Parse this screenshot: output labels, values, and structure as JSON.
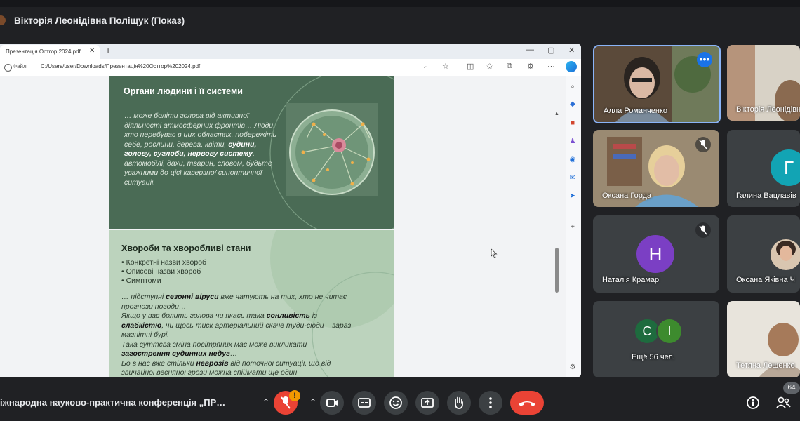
{
  "presenter": {
    "title": "Вікторія Леонідівна Поліщук (Показ)"
  },
  "browser": {
    "tab_title": "Презентація Остгор 2024.pdf",
    "address_prefix": "Файл",
    "address_url": "C:/Users/user/Downloads/Презентація%20Остгор%202024.pdf"
  },
  "slide1": {
    "title": "Органи людини і її системи",
    "text_1": "… може боліти голова від активної діяльності атмосферних фронтів… Люди, хто перебуває в цих областях, побережіть себе, рослини, дерева, квіти, ",
    "text_bold": "судини, голову, суглоби, нервову систему",
    "text_2": ", автомобілі, дахи, тварин, словом, будьте уважними до цієї каверзної синоптичної ситуації."
  },
  "slide2": {
    "title": "Хвороби та хворобливі стани",
    "list": [
      "Конкретні назви хвороб",
      "Описові назви хвороб",
      "Симптоми"
    ],
    "p1_a": "… підступні ",
    "p1_b": "сезонні віруси",
    "p1_c": " вже чатують на тих, хто не читає прогнози погоди…",
    "p2_a": "Якщо у вас болить голова чи якась така ",
    "p2_b": "сонливість",
    "p2_c": " із ",
    "p2_d": "слабкістю",
    "p2_e": ", чи щось тиск артеріальний скаче туди-сюди – зараз магнітні бурі.",
    "p3_a": "Така суттєва зміна повітряних мас може викликати ",
    "p3_b": "загострення судинних недуг",
    "p3_c": "…",
    "p4_a": "Бо в нас вже стільки ",
    "p4_b": "неврозів",
    "p4_c": " від поточної ситуації, що від звичайної весняної грози можна спіймати ще один"
  },
  "participants": [
    {
      "name": "Алла Романченко"
    },
    {
      "name": "Вікторія Леонідівна"
    },
    {
      "name": "Оксана Горда"
    },
    {
      "name": "Галина Вацлавів",
      "initial": "Г",
      "color": "#12a4b4"
    },
    {
      "name": "Наталія Крамар",
      "initial": "Н",
      "color": "#7b3fc4"
    },
    {
      "name": "Оксана Яківна Ч"
    },
    {
      "name": "Ещё 56 чел.",
      "initials": [
        "С",
        "І"
      ],
      "colors": [
        "#1e6b3e",
        "#3d8b2e"
      ]
    },
    {
      "name": "Тетяна Лещенко"
    }
  ],
  "bottom": {
    "meeting_name": "іжнародна науково-практична конференція „ПР…",
    "mic_badge": "!",
    "people_count": "64"
  },
  "colors": {
    "end_call": "#ea4335",
    "accent_blue": "#8ab4f8"
  }
}
